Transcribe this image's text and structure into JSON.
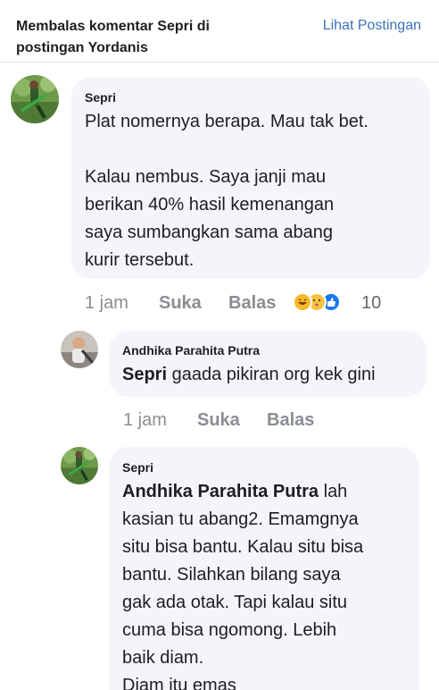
{
  "header": {
    "title_line1": "Membalas komentar Sepri di",
    "title_line2": "postingan Yordanis",
    "view_post": "Lihat Postingan"
  },
  "comments": [
    {
      "author": "Sepri",
      "lines": [
        "Plat nomernya berapa. Mau tak bet.",
        "",
        "Kalau nembus. Saya janji mau",
        "berikan 40% hasil kemenangan",
        "saya sumbangkan sama abang",
        "kurir tersebut."
      ],
      "time": "1 jam",
      "like": "Suka",
      "reply": "Balas",
      "reaction_icons": [
        "haha-icon",
        "care-icon",
        "like-icon"
      ],
      "reaction_count": "10"
    },
    {
      "author": "Andhika Parahita Putra",
      "mention": "Sepri",
      "text": " gaada pikiran org kek gini",
      "time": "1 jam",
      "like": "Suka",
      "reply": "Balas"
    },
    {
      "author": "Sepri",
      "mention": "Andhika Parahita Putra",
      "first_line_rest": " lah",
      "lines": [
        "kasian tu abang2. Emamgnya",
        "situ bisa bantu. Kalau situ bisa",
        "bantu. Silahkan bilang saya",
        "gak ada otak. Tapi kalau situ",
        "cuma bisa ngomong. Lebih",
        "baik diam.",
        "Diam itu emas"
      ]
    }
  ],
  "colors": {
    "bubble": "#f7f3fb",
    "link": "#3b72b8",
    "muted": "#8a8d91",
    "haha": "#f7b928",
    "like": "#1877f2"
  }
}
